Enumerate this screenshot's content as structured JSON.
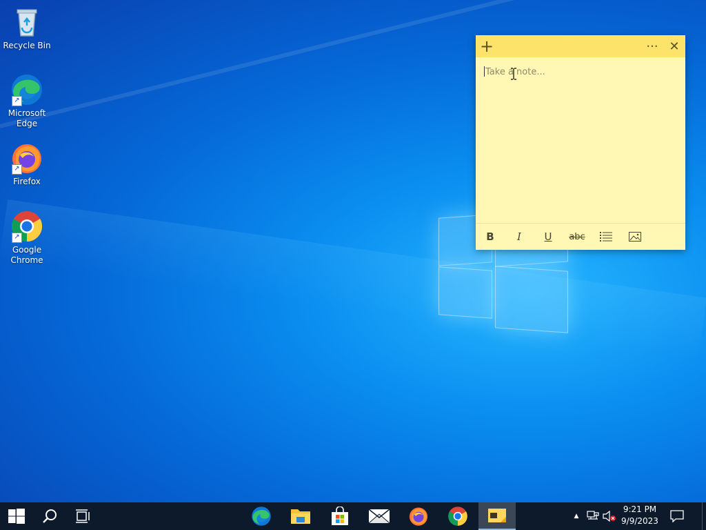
{
  "desktop": {
    "icons": [
      {
        "label": "Recycle Bin"
      },
      {
        "label": "Microsoft Edge"
      },
      {
        "label": "Firefox"
      },
      {
        "label": "Google Chrome"
      }
    ]
  },
  "sticky_note": {
    "add_glyph": "+",
    "menu_glyph": "···",
    "close_glyph": "✕",
    "placeholder": "Take a note...",
    "toolbar": {
      "bold": "B",
      "italic": "I",
      "underline": "U",
      "strikethrough": "abc"
    },
    "colors": {
      "header": "#fde36a",
      "body": "#fff7b3"
    }
  },
  "taskbar": {
    "tray_expand": "▲",
    "time": "9:21 PM",
    "date": "9/9/2023"
  }
}
